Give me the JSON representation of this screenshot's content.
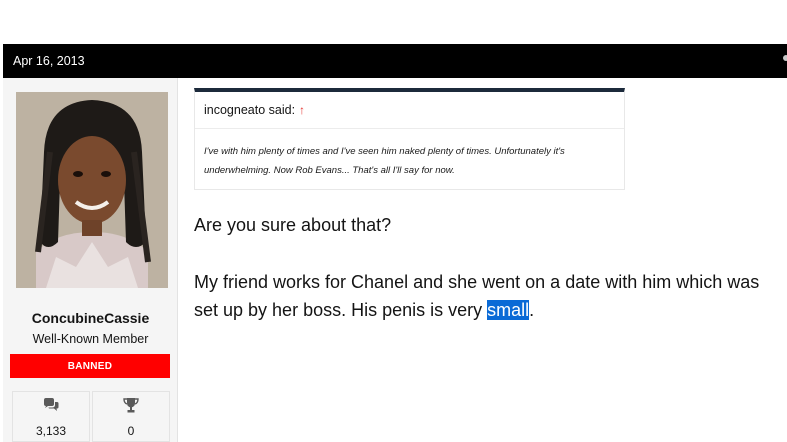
{
  "post": {
    "date": "Apr 16, 2013"
  },
  "author": {
    "username": "ConcubineCassie",
    "title": "Well-Known Member",
    "banner": "BANNED",
    "stats": [
      {
        "icon": "comments-icon",
        "value": "3,133"
      },
      {
        "icon": "trophy-icon",
        "value": "0"
      }
    ]
  },
  "quote": {
    "author_label": "incogneato said:",
    "arrow": "↑",
    "text": "I've with him plenty of times and I've seen him naked plenty of times. Unfortunately it's underwhelming. Now Rob Evans... That's all I'll say for now."
  },
  "message": {
    "line1": "Are you sure about that?",
    "line2_before": "My friend works for Chanel and she went on a date with him which was set up by her boss. His penis is very ",
    "line2_highlight": "small",
    "line2_after": "."
  },
  "colors": {
    "postbar_bg": "#000000",
    "banner_bg": "#ff0000",
    "selection": "#0a6ad6",
    "quote_border": "#1c2a3b"
  }
}
